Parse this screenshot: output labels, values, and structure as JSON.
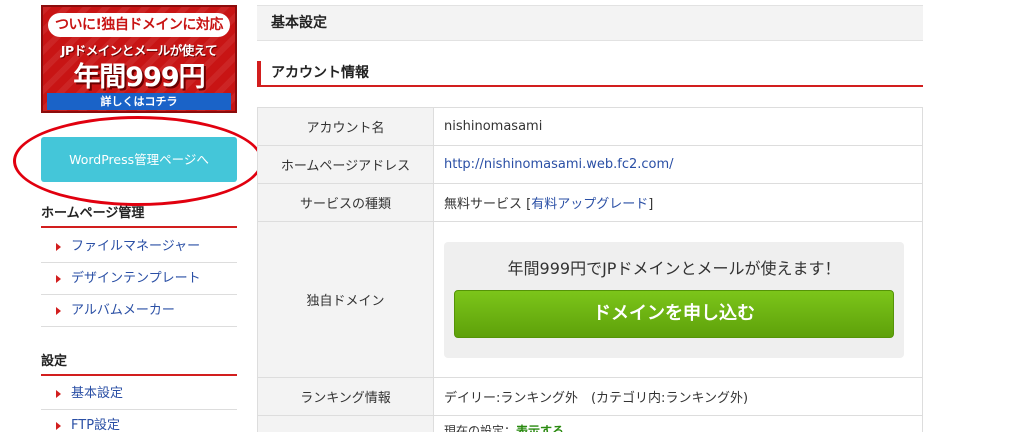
{
  "sidebar": {
    "promo": {
      "top_text": "ついに!独自ドメインに対応",
      "mid_text": "JPドメインとメールが使えて",
      "price_text": "年間999円",
      "more_text": "詳しくはコチラ"
    },
    "wp_button": "WordPress管理ページへ",
    "sections": [
      {
        "heading": "ホームページ管理",
        "items": [
          "ファイルマネージャー",
          "デザインテンプレート",
          "アルバムメーカー"
        ]
      },
      {
        "heading": "設定",
        "items": [
          "基本設定",
          "FTP設定"
        ]
      }
    ]
  },
  "main": {
    "title": "基本設定",
    "section_heading": "アカウント情報",
    "rows": {
      "account_label": "アカウント名",
      "account_value": "nishinomasami",
      "homepage_label": "ホームページアドレス",
      "homepage_value": "http://nishinomasami.web.fc2.com/",
      "service_label": "サービスの種類",
      "service_value": "無料サービス",
      "service_bracket_open": "[",
      "service_upgrade": "有料アップグレード",
      "service_bracket_close": "]",
      "domain_label": "独自ドメイン",
      "domain_message": "年間999円でJPドメインとメールが使えます！",
      "domain_button": "ドメインを申し込む",
      "ranking_label": "ランキング情報",
      "ranking_value": "デイリー:ランキング外　(カテゴリ内:ランキング外)",
      "last_prefix": "現在の設定：",
      "last_value": "表示する"
    }
  },
  "colors": {
    "accent_red": "#d21e1e",
    "link_blue": "#2a4fa5",
    "wp_button": "#44c6d9",
    "domain_button": "#6db511",
    "annotation_circle": "#e1000f"
  }
}
